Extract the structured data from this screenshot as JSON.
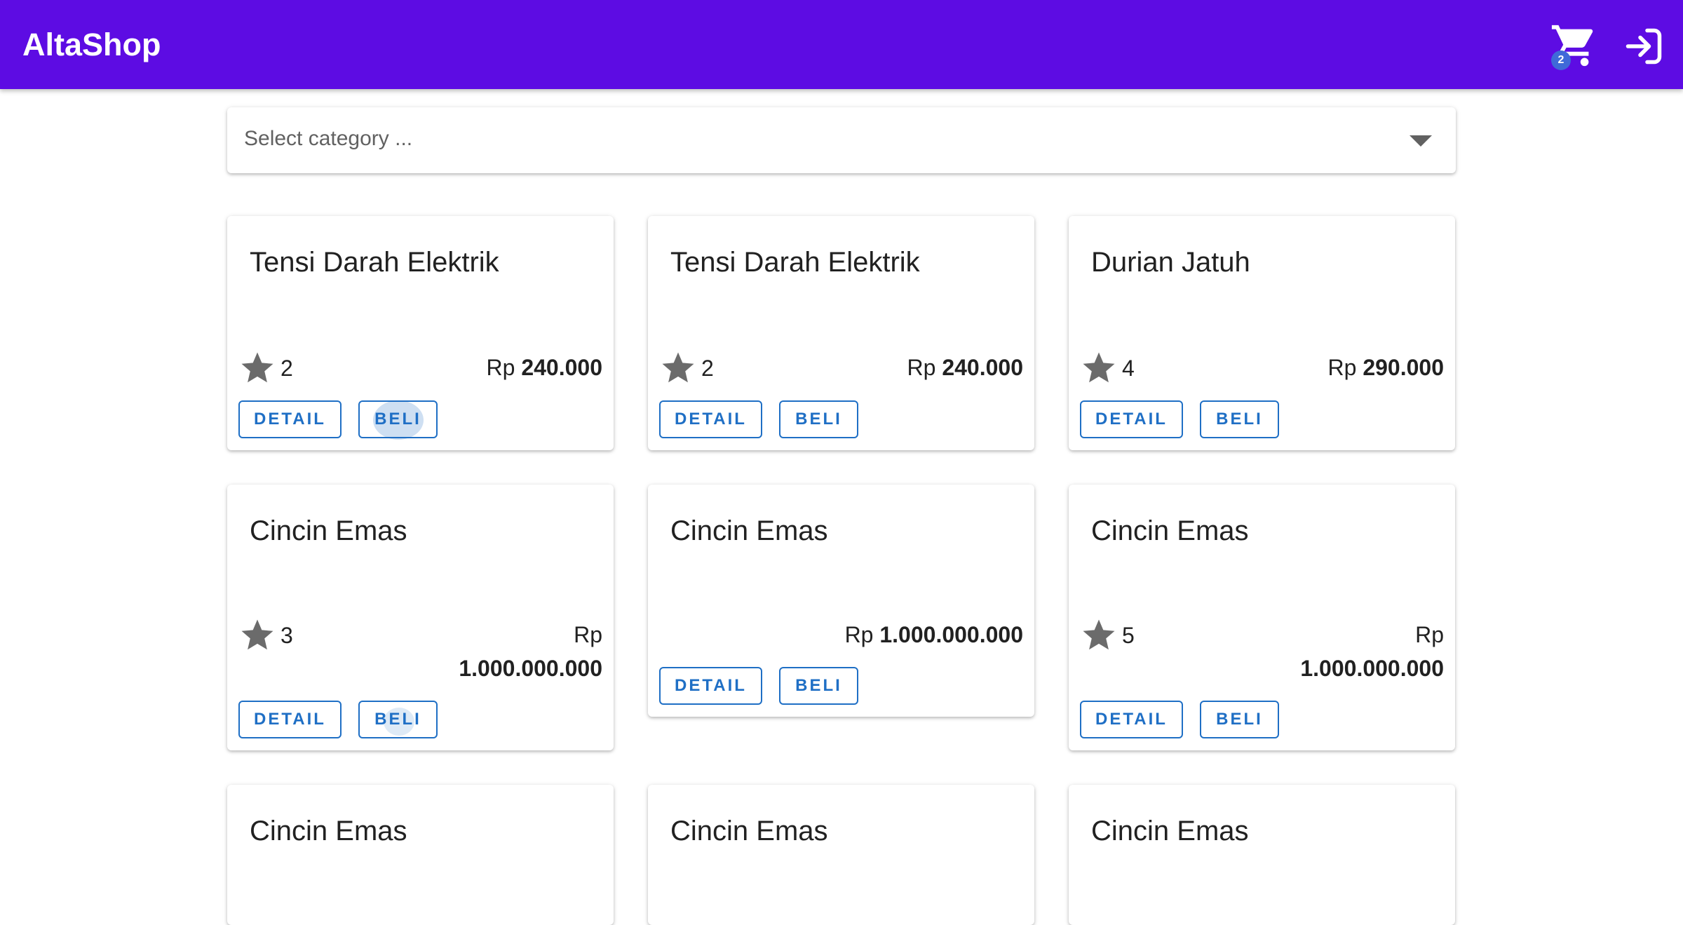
{
  "header": {
    "brand": "AltaShop",
    "cart_count": "2",
    "background": "#5d0ce3"
  },
  "filter": {
    "placeholder": "Select category ..."
  },
  "products": [
    {
      "title": "Tensi Darah Elektrik",
      "rating": "2",
      "currency": "Rp",
      "price": "240.000",
      "detail_label": "DETAIL",
      "buy_label": "BELI"
    },
    {
      "title": "Tensi Darah Elektrik",
      "rating": "2",
      "currency": "Rp",
      "price": "240.000",
      "detail_label": "DETAIL",
      "buy_label": "BELI"
    },
    {
      "title": "Durian Jatuh",
      "rating": "4",
      "currency": "Rp",
      "price": "290.000",
      "detail_label": "DETAIL",
      "buy_label": "BELI"
    },
    {
      "title": "Cincin Emas",
      "rating": "3",
      "currency": "Rp",
      "price": "1.000.000.000",
      "detail_label": "DETAIL",
      "buy_label": "BELI"
    },
    {
      "title": "Cincin Emas",
      "currency": "Rp",
      "price": "1.000.000.000",
      "detail_label": "DETAIL",
      "buy_label": "BELI"
    },
    {
      "title": "Cincin Emas",
      "rating": "5",
      "currency": "Rp",
      "price": "1.000.000.000",
      "detail_label": "DETAIL",
      "buy_label": "BELI"
    },
    {
      "title": "Cincin Emas"
    },
    {
      "title": "Cincin Emas"
    },
    {
      "title": "Cincin Emas"
    }
  ],
  "icons": {
    "cart": "shopping-cart-icon",
    "login": "login-icon",
    "star": "star-icon",
    "dropdown": "caret-down-icon"
  },
  "colors": {
    "accent": "#1f6fc5",
    "star": "#6b6b6b"
  }
}
